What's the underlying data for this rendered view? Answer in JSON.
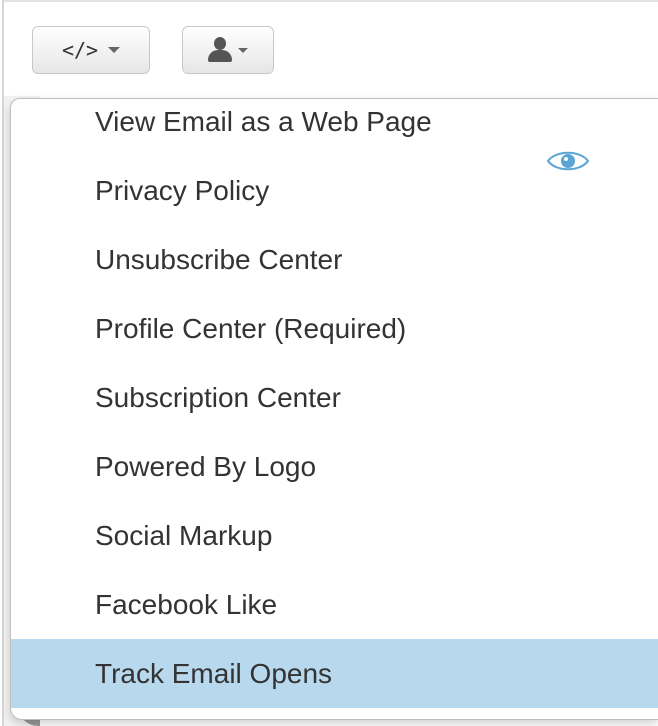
{
  "toolbar": {
    "code_button_label": "</>",
    "code_button_icon": "code-icon",
    "user_button_icon": "user-icon",
    "caret_icon": "caret-down-icon"
  },
  "menu": {
    "items": [
      {
        "label": "View Email as a Web Page"
      },
      {
        "label": "Privacy Policy"
      },
      {
        "label": "Unsubscribe Center"
      },
      {
        "label": "Profile Center (Required)"
      },
      {
        "label": "Subscription Center"
      },
      {
        "label": "Powered By Logo"
      },
      {
        "label": "Social Markup"
      },
      {
        "label": "Facebook Like"
      },
      {
        "label": "Track Email Opens"
      }
    ],
    "highlighted_item": "Track Email Opens",
    "preview_icon": "eye-icon"
  },
  "colors": {
    "highlight": "#b8d9ed",
    "text": "#333333",
    "eye": "#5ba4d6"
  }
}
